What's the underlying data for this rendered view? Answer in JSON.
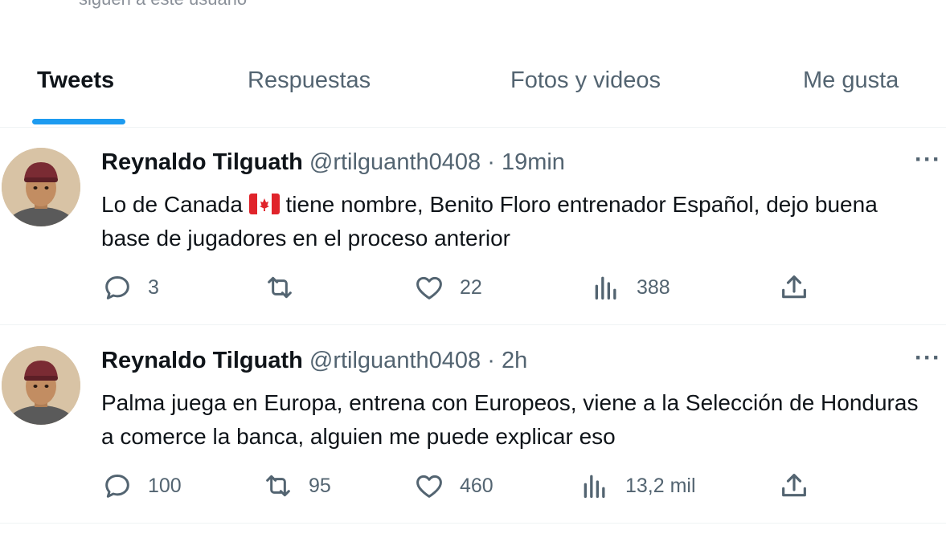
{
  "header": {
    "partial_text": "siguen a este usuario"
  },
  "tabs": [
    {
      "label": "Tweets",
      "active": true
    },
    {
      "label": "Respuestas",
      "active": false
    },
    {
      "label": "Fotos y videos",
      "active": false
    },
    {
      "label": "Me gusta",
      "active": false
    }
  ],
  "colors": {
    "accent": "#1d9bf0",
    "muted": "#536471",
    "text": "#0f1419"
  },
  "tweets": [
    {
      "name": "Reynaldo Tilguath",
      "handle": "@rtilguanth0408",
      "separator": "·",
      "time": "19min",
      "text_before_flag": "Lo de Canada",
      "flag_icon": "canada-flag-icon",
      "text_after_flag": "tiene nombre,  Benito Floro entrenador Español,  dejo buena base de jugadores en el  proceso  anterior",
      "replies": "3",
      "retweets": "",
      "likes": "22",
      "views": "388"
    },
    {
      "name": "Reynaldo Tilguath",
      "handle": "@rtilguanth0408",
      "separator": "·",
      "time": "2h",
      "text": "Palma juega en Europa, entrena con Europeos, viene a la Selección de Honduras a comerce la banca, alguien me puede explicar eso",
      "replies": "100",
      "retweets": "95",
      "likes": "460",
      "views": "13,2 mil"
    }
  ]
}
